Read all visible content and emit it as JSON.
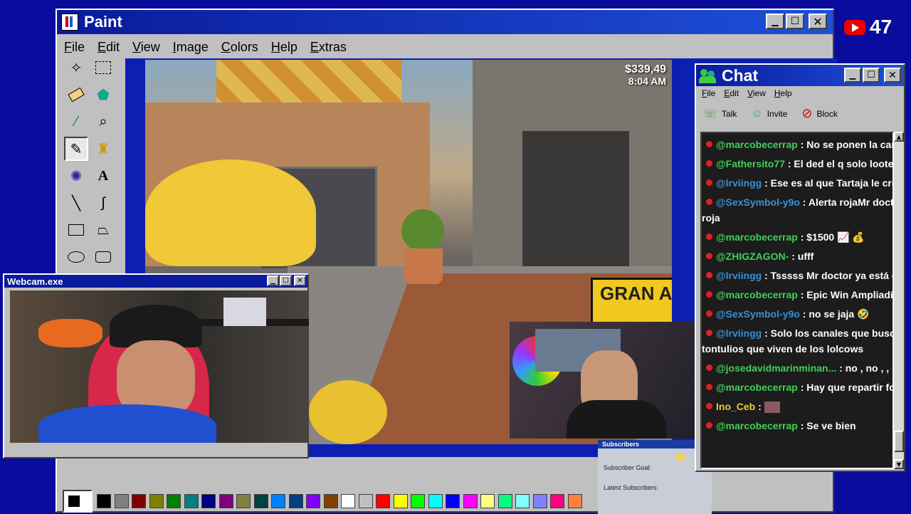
{
  "paint": {
    "title": "Paint",
    "menu": [
      "File",
      "Edit",
      "View",
      "Image",
      "Colors",
      "Help",
      "Extras"
    ]
  },
  "game_hud": {
    "money": "$339,49",
    "time": "8:04 AM",
    "sign": "GRAN APERTUR"
  },
  "webcam": {
    "title": "Webcam.exe"
  },
  "youtube": {
    "count": "47"
  },
  "chat": {
    "title": "Chat",
    "menu": [
      "File",
      "Edit",
      "View",
      "Help"
    ],
    "toolbar": {
      "talk": "Talk",
      "invite": "Invite",
      "block": "Block"
    },
    "messages": [
      {
        "user": "@marcobecerrap",
        "text": "No se ponen la camiseta",
        "color": "#3fd05a"
      },
      {
        "user": "@Fathersito77",
        "text": "El ded el q solo lootea en wa",
        "color": "#3fd05a"
      },
      {
        "user": "@lrviingg",
        "text": "Ese es al que Tartaja le croma el",
        "color": "#3b8fd0"
      },
      {
        "user": "@SexSymbol-y9o",
        "text": "Alerta rojaMr doctor ara",
        "cont": "roja",
        "color": "#3b8fd0"
      },
      {
        "user": "@marcobecerrap",
        "text": "$1500 📈 💰",
        "color": "#3fd05a"
      },
      {
        "user": "@ZHIGZAGON-",
        "text": "ufff",
        "color": "#3fd05a"
      },
      {
        "user": "@lrviingg",
        "text": "Tsssss Mr doctor ya está en la de",
        "color": "#3b8fd0"
      },
      {
        "user": "@marcobecerrap",
        "text": "Epic Win Ampliadín 😎",
        "color": "#3fd05a"
      },
      {
        "user": "@SexSymbol-y9o",
        "text": "no se jaja 🤣",
        "color": "#3b8fd0"
      },
      {
        "user": "@lrviingg",
        "text": "Solo los canales que buscan raso",
        "cont": "tontulios que viven de los lolcows",
        "color": "#3b8fd0"
      },
      {
        "user": "@josedavidmarinminan...",
        "text": "no , no , , no. si",
        "color": "#3fd05a"
      },
      {
        "user": "@marcobecerrap",
        "text": "Hay que repartir folletos",
        "color": "#3fd05a"
      },
      {
        "user": "Ino_Ceb",
        "text": "",
        "color": "#e8c840",
        "emote": true
      },
      {
        "user": "@marcobecerrap",
        "text": "Se ve bien",
        "color": "#3fd05a"
      }
    ]
  },
  "subs_widget": {
    "header": "Subscribers",
    "goal": "Subscriber Goal:",
    "latest": "Latest Subscribers:"
  },
  "palette": [
    "#000000",
    "#808080",
    "#800000",
    "#808000",
    "#008000",
    "#008080",
    "#000080",
    "#800080",
    "#808040",
    "#004040",
    "#0080ff",
    "#004080",
    "#8000ff",
    "#804000",
    "#ffffff",
    "#c0c0c0",
    "#ff0000",
    "#ffff00",
    "#00ff00",
    "#00ffff",
    "#0000ff",
    "#ff00ff",
    "#ffff80",
    "#00ff80",
    "#80ffff",
    "#8080ff",
    "#ff0080",
    "#ff8040"
  ]
}
